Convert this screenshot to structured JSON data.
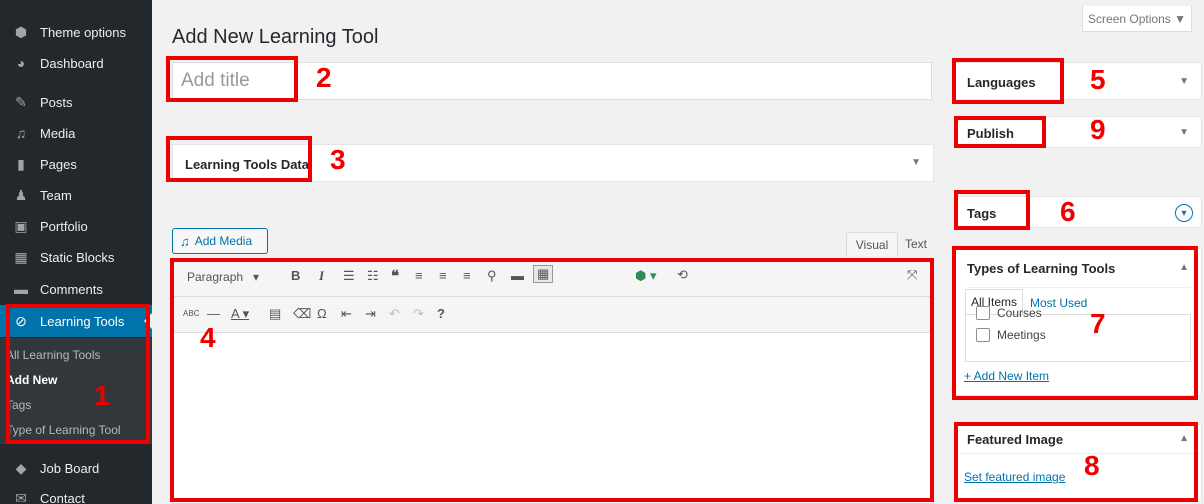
{
  "sidebar": {
    "items": [
      {
        "label": "Theme options",
        "icon": "hexagon-icon"
      },
      {
        "label": "Dashboard",
        "icon": "dashboard-icon"
      },
      {
        "label": "Posts",
        "icon": "pin-icon"
      },
      {
        "label": "Media",
        "icon": "media-icon"
      },
      {
        "label": "Pages",
        "icon": "pages-icon"
      },
      {
        "label": "Team",
        "icon": "people-icon"
      },
      {
        "label": "Portfolio",
        "icon": "portfolio-icon"
      },
      {
        "label": "Static Blocks",
        "icon": "blocks-icon"
      },
      {
        "label": "Comments",
        "icon": "comment-icon"
      },
      {
        "label": "Learning Tools",
        "icon": "paperclip-icon"
      },
      {
        "label": "Job Board",
        "icon": "tag-icon"
      },
      {
        "label": "Contact",
        "icon": "envelope-icon"
      }
    ],
    "submenu": [
      "All Learning Tools",
      "Add New",
      "Tags",
      "Type of Learning Tool"
    ]
  },
  "header": {
    "screen_options": "Screen Options ▼",
    "title": "Add New Learning Tool"
  },
  "title_input": {
    "placeholder": "Add title"
  },
  "learning_tools_box": {
    "title": "Learning Tools Data"
  },
  "editor": {
    "add_media": "Add Media",
    "tabs": [
      "Visual",
      "Text"
    ],
    "format_select": "Paragraph"
  },
  "side": {
    "languages": "Languages",
    "publish": "Publish",
    "tags": "Tags",
    "types": {
      "title": "Types of Learning Tools",
      "tabs": [
        "All Items",
        "Most Used"
      ],
      "items": [
        "Courses",
        "Meetings"
      ],
      "add_new": "+ Add New Item"
    },
    "featured": {
      "title": "Featured Image",
      "link": "Set featured image"
    }
  },
  "annotations": [
    "1",
    "2",
    "3",
    "4",
    "5",
    "6",
    "7",
    "8",
    "9"
  ],
  "colors": {
    "annotation": "#e00000",
    "accent": "#0073aa",
    "sidebar": "#23282d"
  }
}
